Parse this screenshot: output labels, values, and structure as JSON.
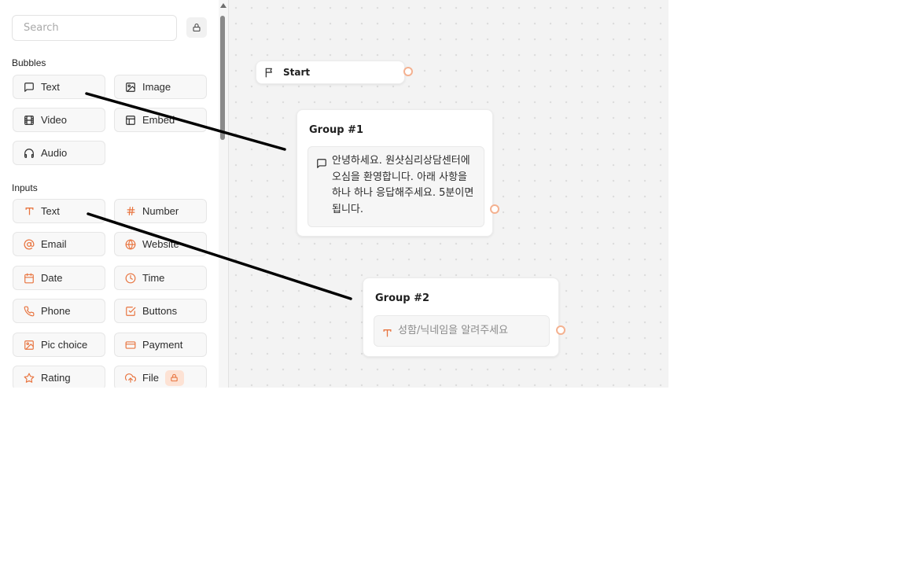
{
  "sidebar": {
    "search": {
      "placeholder": "Search",
      "value": ""
    },
    "lock_icon": "lock-icon",
    "sections": {
      "bubbles": {
        "title": "Bubbles",
        "items": [
          {
            "label": "Text",
            "icon": "chat-bubble-icon"
          },
          {
            "label": "Image",
            "icon": "image-icon"
          },
          {
            "label": "Video",
            "icon": "film-icon"
          },
          {
            "label": "Embed",
            "icon": "layout-icon"
          },
          {
            "label": "Audio",
            "icon": "headphones-icon"
          }
        ]
      },
      "inputs": {
        "title": "Inputs",
        "items": [
          {
            "label": "Text",
            "icon": "text-t-icon"
          },
          {
            "label": "Number",
            "icon": "hash-icon"
          },
          {
            "label": "Email",
            "icon": "at-sign-icon"
          },
          {
            "label": "Website",
            "icon": "globe-icon"
          },
          {
            "label": "Date",
            "icon": "calendar-icon"
          },
          {
            "label": "Time",
            "icon": "clock-icon"
          },
          {
            "label": "Phone",
            "icon": "phone-icon"
          },
          {
            "label": "Buttons",
            "icon": "checkbox-icon"
          },
          {
            "label": "Pic choice",
            "icon": "image-choice-icon"
          },
          {
            "label": "Payment",
            "icon": "credit-card-icon"
          },
          {
            "label": "Rating",
            "icon": "star-icon"
          },
          {
            "label": "File",
            "icon": "upload-icon",
            "badge_icon": "lock-icon"
          }
        ]
      }
    }
  },
  "canvas": {
    "start_node": {
      "label": "Start",
      "icon": "flag-icon"
    },
    "groups": [
      {
        "title": "Group #1",
        "block": {
          "icon": "chat-bubble-icon",
          "lines": [
            "안녕하세요. 원샷심리상담센터에",
            "오심을 환영합니다. 아래 사항을",
            "하나 하나 응답해주세요. 5분이면",
            "됩니다."
          ]
        }
      },
      {
        "title": "Group #2",
        "block": {
          "icon": "text-t-icon",
          "placeholder": "성함/닉네임을 알려주세요"
        }
      }
    ]
  },
  "colors": {
    "accent": "#e8743f",
    "connector": "#f4b190",
    "canvas_bg": "#f3f3f3",
    "pro_badge": "#fde2d4"
  }
}
